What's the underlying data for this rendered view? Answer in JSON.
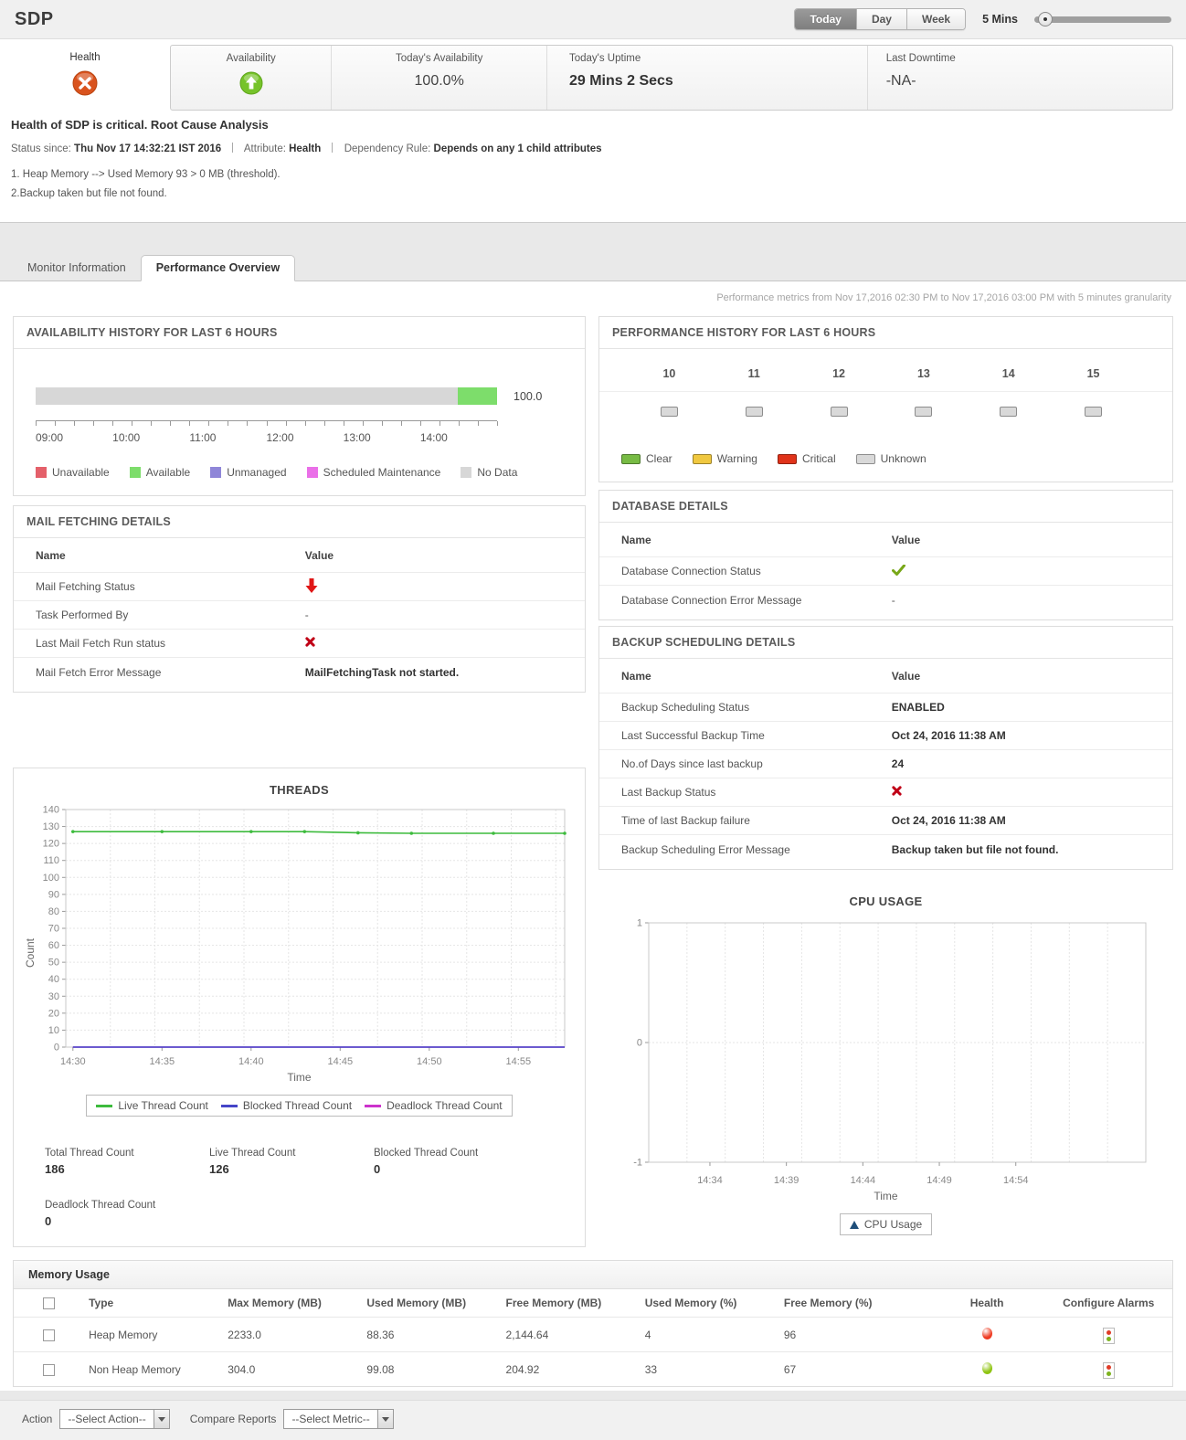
{
  "header": {
    "title": "SDP",
    "period_buttons": [
      "Today",
      "Day",
      "Week"
    ],
    "selected_period": "Today",
    "interval_label": "5 Mins"
  },
  "status": {
    "health_label": "Health",
    "availability_label": "Availability",
    "todays_availability_label": "Today's Availability",
    "todays_availability_value": "100.0%",
    "todays_uptime_label": "Today's Uptime",
    "todays_uptime_value": "29 Mins 2 Secs",
    "last_downtime_label": "Last Downtime",
    "last_downtime_value": "-NA-"
  },
  "alert": {
    "title": "Health of SDP is critical. Root Cause Analysis",
    "status_since_label": "Status since:",
    "status_since_value": "Thu Nov 17 14:32:21 IST 2016",
    "attribute_label": "Attribute:",
    "attribute_value": "Health",
    "dependency_label": "Dependency Rule:",
    "dependency_value": "Depends on any 1 child attributes",
    "causes": [
      "1. Heap Memory --> Used Memory 93 > 0 MB (threshold).",
      "2.Backup taken but file not found."
    ]
  },
  "tabs": [
    {
      "label": "Monitor Information",
      "active": false
    },
    {
      "label": "Performance Overview",
      "active": true
    }
  ],
  "metrics_note": "Performance metrics from Nov 17,2016 02:30 PM to Nov 17,2016 03:00 PM with 5 minutes granularity",
  "availability_history": {
    "title": "AVAILABILITY HISTORY FOR LAST 6 HOURS",
    "value_label": "100.0",
    "segments": [
      {
        "name": "No Data",
        "color": "#d7d7d7",
        "pct": 91.5
      },
      {
        "name": "Available",
        "color": "#7ddd6b",
        "pct": 8.5
      }
    ],
    "x_ticks": [
      "09:00",
      "10:00",
      "11:00",
      "12:00",
      "13:00",
      "14:00"
    ],
    "legend": [
      {
        "label": "Unavailable",
        "color": "#e4606a"
      },
      {
        "label": "Available",
        "color": "#7ddd6b"
      },
      {
        "label": "Unmanaged",
        "color": "#8f86d8"
      },
      {
        "label": "Scheduled Maintenance",
        "color": "#ea6fe8"
      },
      {
        "label": "No Data",
        "color": "#d7d7d7"
      }
    ]
  },
  "performance_history": {
    "title": "PERFORMANCE HISTORY FOR LAST 6 HOURS",
    "hours": [
      "10",
      "11",
      "12",
      "13",
      "14",
      "15"
    ],
    "states": [
      "Unknown",
      "Unknown",
      "Unknown",
      "Unknown",
      "Unknown",
      "Unknown"
    ],
    "legend": [
      {
        "label": "Clear",
        "color": "#77bb44"
      },
      {
        "label": "Warning",
        "color": "#f0c840"
      },
      {
        "label": "Critical",
        "color": "#e0331a"
      },
      {
        "label": "Unknown",
        "color": "#d9d9d9"
      }
    ]
  },
  "mail_fetching": {
    "title": "MAIL FETCHING DETAILS",
    "name_header": "Name",
    "value_header": "Value",
    "rows": [
      {
        "name": "Mail Fetching Status",
        "type": "arrow-down",
        "value": "down"
      },
      {
        "name": "Task Performed By",
        "type": "text",
        "value": "-"
      },
      {
        "name": "Last Mail Fetch Run status",
        "type": "cross",
        "value": "failed"
      },
      {
        "name": "Mail Fetch Error Message",
        "type": "bold",
        "value": "MailFetchingTask not started."
      }
    ]
  },
  "database_details": {
    "title": "DATABASE DETAILS",
    "name_header": "Name",
    "value_header": "Value",
    "rows": [
      {
        "name": "Database Connection Status",
        "type": "check",
        "value": "ok"
      },
      {
        "name": "Database Connection Error Message",
        "type": "text",
        "value": "-"
      }
    ]
  },
  "backup_details": {
    "title": "BACKUP SCHEDULING DETAILS",
    "name_header": "Name",
    "value_header": "Value",
    "rows": [
      {
        "name": "Backup Scheduling Status",
        "type": "bold",
        "value": "ENABLED"
      },
      {
        "name": "Last Successful Backup Time",
        "type": "bold",
        "value": "Oct 24, 2016 11:38 AM"
      },
      {
        "name": "No.of Days since last backup",
        "type": "bold",
        "value": "24"
      },
      {
        "name": "Last Backup Status",
        "type": "cross",
        "value": "failed"
      },
      {
        "name": "Time of last Backup failure",
        "type": "bold",
        "value": "Oct 24, 2016 11:38 AM"
      },
      {
        "name": "Backup Scheduling Error Message",
        "type": "bold",
        "value": "Backup taken but file not found."
      }
    ]
  },
  "chart_data": [
    {
      "type": "line",
      "title": "THREADS",
      "xlabel": "Time",
      "ylabel": "Count",
      "ylim": [
        0,
        140
      ],
      "yticks": [
        0,
        10,
        20,
        30,
        40,
        50,
        60,
        70,
        80,
        90,
        100,
        110,
        120,
        130,
        140
      ],
      "xmin": 0,
      "xmax": 28,
      "minor_grid_minutes": 2.5,
      "x_ticks": [
        {
          "label": "14:30",
          "m": 0.4
        },
        {
          "label": "14:35",
          "m": 5.4
        },
        {
          "label": "14:40",
          "m": 10.4
        },
        {
          "label": "14:45",
          "m": 15.4
        },
        {
          "label": "14:50",
          "m": 20.4
        },
        {
          "label": "14:55",
          "m": 25.4
        }
      ],
      "series": [
        {
          "name": "Deadlock Thread Count",
          "color": "#cc33cc",
          "markers": false,
          "points": [
            [
              0.4,
              0
            ],
            [
              28,
              0
            ]
          ]
        },
        {
          "name": "Blocked Thread Count",
          "color": "#4545c8",
          "markers": false,
          "points": [
            [
              0.4,
              0
            ],
            [
              28,
              0
            ]
          ]
        },
        {
          "name": "Live Thread Count",
          "color": "#3dbb3d",
          "markers": true,
          "points": [
            [
              0.4,
              127
            ],
            [
              5.4,
              127
            ],
            [
              10.4,
              127
            ],
            [
              13.4,
              127
            ],
            [
              16.4,
              126.3
            ],
            [
              19.4,
              126
            ],
            [
              24,
              126
            ],
            [
              28,
              126
            ]
          ]
        }
      ],
      "legend": [
        {
          "label": "Live Thread Count",
          "color": "#3dbb3d",
          "marker": "line"
        },
        {
          "label": "Blocked Thread Count",
          "color": "#4545c8",
          "marker": "line"
        },
        {
          "label": "Deadlock Thread Count",
          "color": "#cc33cc",
          "marker": "line"
        }
      ]
    },
    {
      "type": "line",
      "title": "CPU USAGE",
      "xlabel": "Time",
      "ylabel": "",
      "ylim": [
        -1,
        1
      ],
      "yticks": [
        -1,
        0,
        1
      ],
      "xmin": 0,
      "xmax": 32.5,
      "minor_grid_minutes": 2.5,
      "x_ticks": [
        {
          "label": "14:34",
          "m": 4
        },
        {
          "label": "14:39",
          "m": 9
        },
        {
          "label": "14:44",
          "m": 14
        },
        {
          "label": "14:49",
          "m": 19
        },
        {
          "label": "14:54",
          "m": 24
        }
      ],
      "series": [],
      "legend": [
        {
          "label": "CPU Usage",
          "color": "#1f4e79",
          "marker": "triangle"
        }
      ]
    }
  ],
  "thread_stats": [
    {
      "label": "Total Thread Count",
      "value": "186"
    },
    {
      "label": "Live Thread Count",
      "value": "126"
    },
    {
      "label": "Blocked Thread Count",
      "value": "0"
    },
    {
      "label": "Deadlock Thread Count",
      "value": "0"
    }
  ],
  "memory_usage": {
    "title": "Memory Usage",
    "columns": [
      "Type",
      "Max Memory  (MB)",
      "Used Memory  (MB)",
      "Free Memory  (MB)",
      "Used Memory  (%)",
      "Free Memory  (%)",
      "Health",
      "Configure Alarms"
    ],
    "rows": [
      {
        "type": "Heap Memory",
        "max_mb": "2233.0",
        "used_mb": "88.36",
        "free_mb": "2,144.64",
        "used_pct": "4",
        "free_pct": "96",
        "health_color": "#ee3b22"
      },
      {
        "type": "Non Heap Memory",
        "max_mb": "304.0",
        "used_mb": "99.08",
        "free_mb": "204.92",
        "used_pct": "33",
        "free_pct": "67",
        "health_color": "#8fc412"
      }
    ],
    "alarm_icon_colors": [
      "#e03c28",
      "#7db31e"
    ]
  },
  "footer": {
    "action_label": "Action",
    "action_value": "--Select Action--",
    "compare_label": "Compare Reports",
    "compare_value": "--Select Metric--"
  },
  "colors": {
    "critical": "#d9531e",
    "ok_green": "#76c32a",
    "cross_red": "#c00016",
    "check_green": "#78a718",
    "arrow_red": "#e01616"
  }
}
